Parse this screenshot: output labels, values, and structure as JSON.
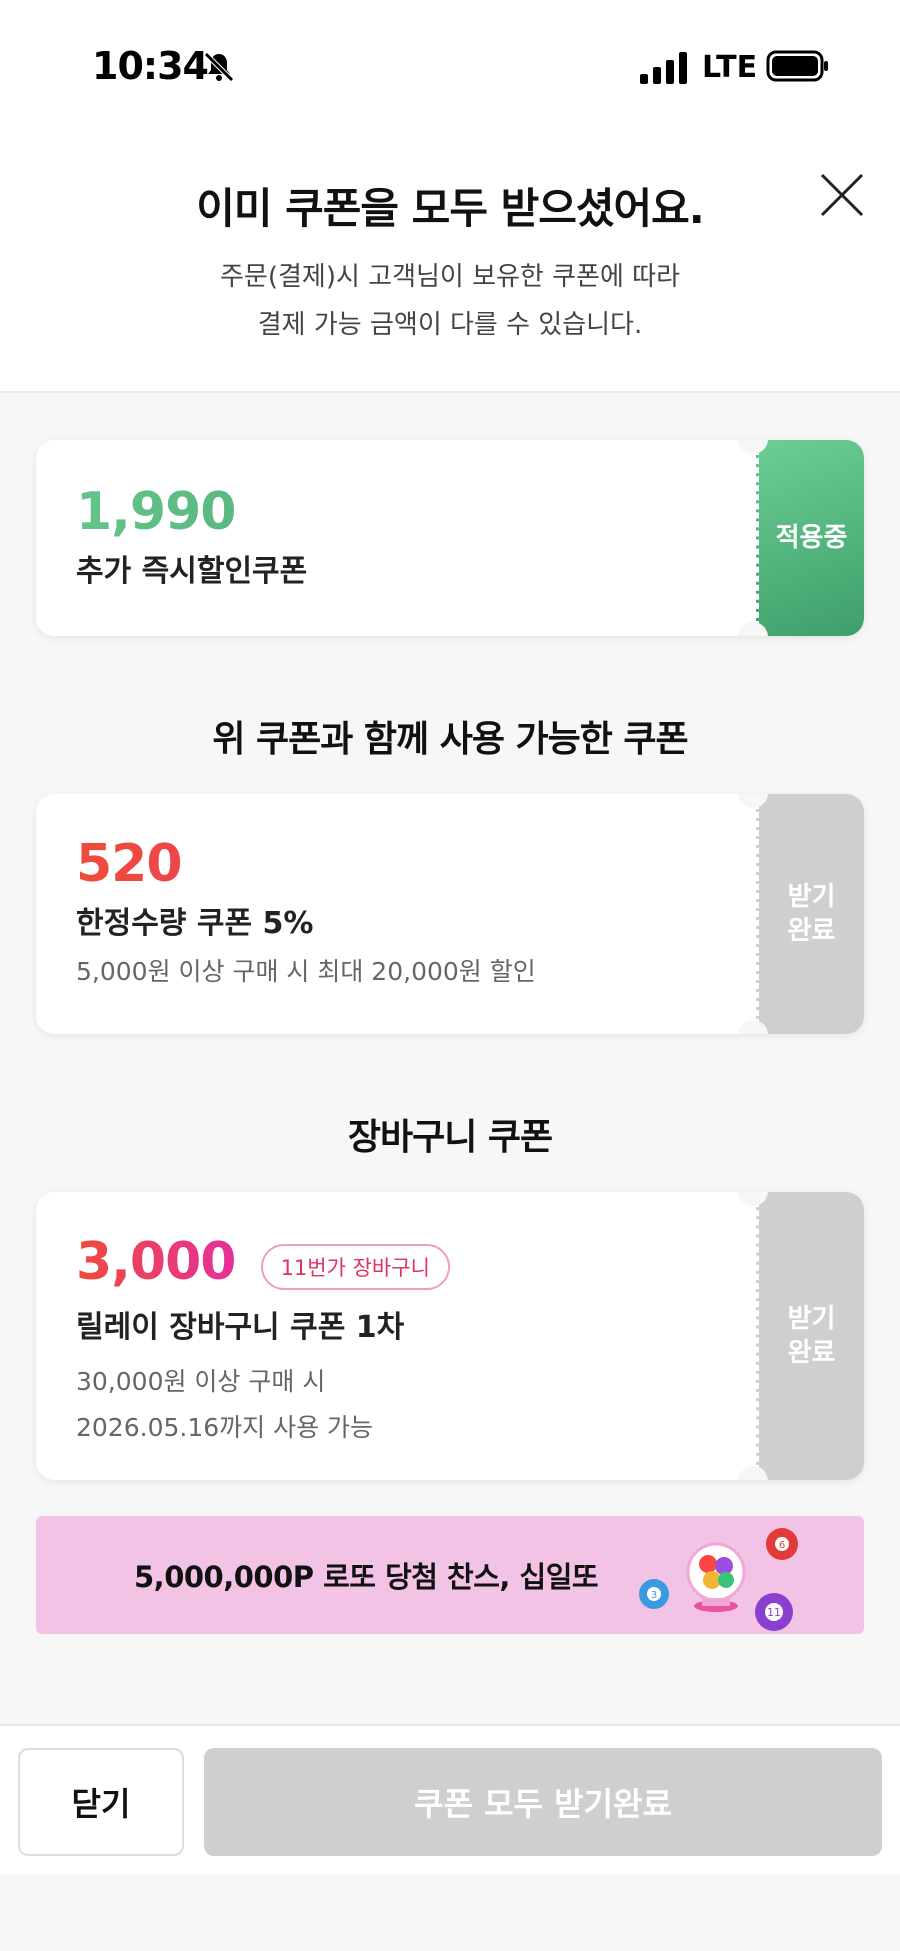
{
  "status_bar": {
    "time": "10:34",
    "network": "LTE",
    "icons": [
      "bell-slash-icon",
      "signal-icon",
      "battery-icon"
    ]
  },
  "header": {
    "title": "이미 쿠폰을 모두 받으셨어요.",
    "desc_line1": "주문(결제)시 고객님이 보유한 쿠폰에 따라",
    "desc_line2": "결제 가능 금액이 다를 수 있습니다.",
    "close_icon": "close-icon"
  },
  "applied_coupon": {
    "amount": "1,990",
    "name": "추가 즉시할인쿠폰",
    "status": "적용중"
  },
  "section_combinable": {
    "title": "위 쿠폰과 함께 사용 가능한 쿠폰"
  },
  "limited_coupon": {
    "amount": "520",
    "name": "한정수량 쿠폰 5%",
    "detail": "5,000원 이상 구매 시 최대 20,000원 할인",
    "status_line1": "받기",
    "status_line2": "완료"
  },
  "section_cart": {
    "title": "장바구니 쿠폰"
  },
  "cart_coupon": {
    "amount": "3,000",
    "badge": "11번가 장바구니",
    "name": "릴레이 장바구니 쿠폰 1차",
    "detail1": "30,000원 이상 구매 시",
    "detail2": "2026.05.16까지 사용 가능",
    "status_line1": "받기",
    "status_line2": "완료"
  },
  "banner": {
    "text": "5,000,000P 로또 당첨 찬스, 십일또",
    "icon": "lotto-machine-icon",
    "ball_labels": [
      "6",
      "3",
      "11"
    ]
  },
  "footer": {
    "close_label": "닫기",
    "receive_all_label": "쿠폰 모두 받기완료"
  },
  "colors": {
    "applied_green": "#4fb57c",
    "highlight_red": "#f04a3a",
    "highlight_pink": "#e5309c",
    "disabled_gray": "#cfcfcf",
    "banner_pink": "#f3c3e6"
  }
}
